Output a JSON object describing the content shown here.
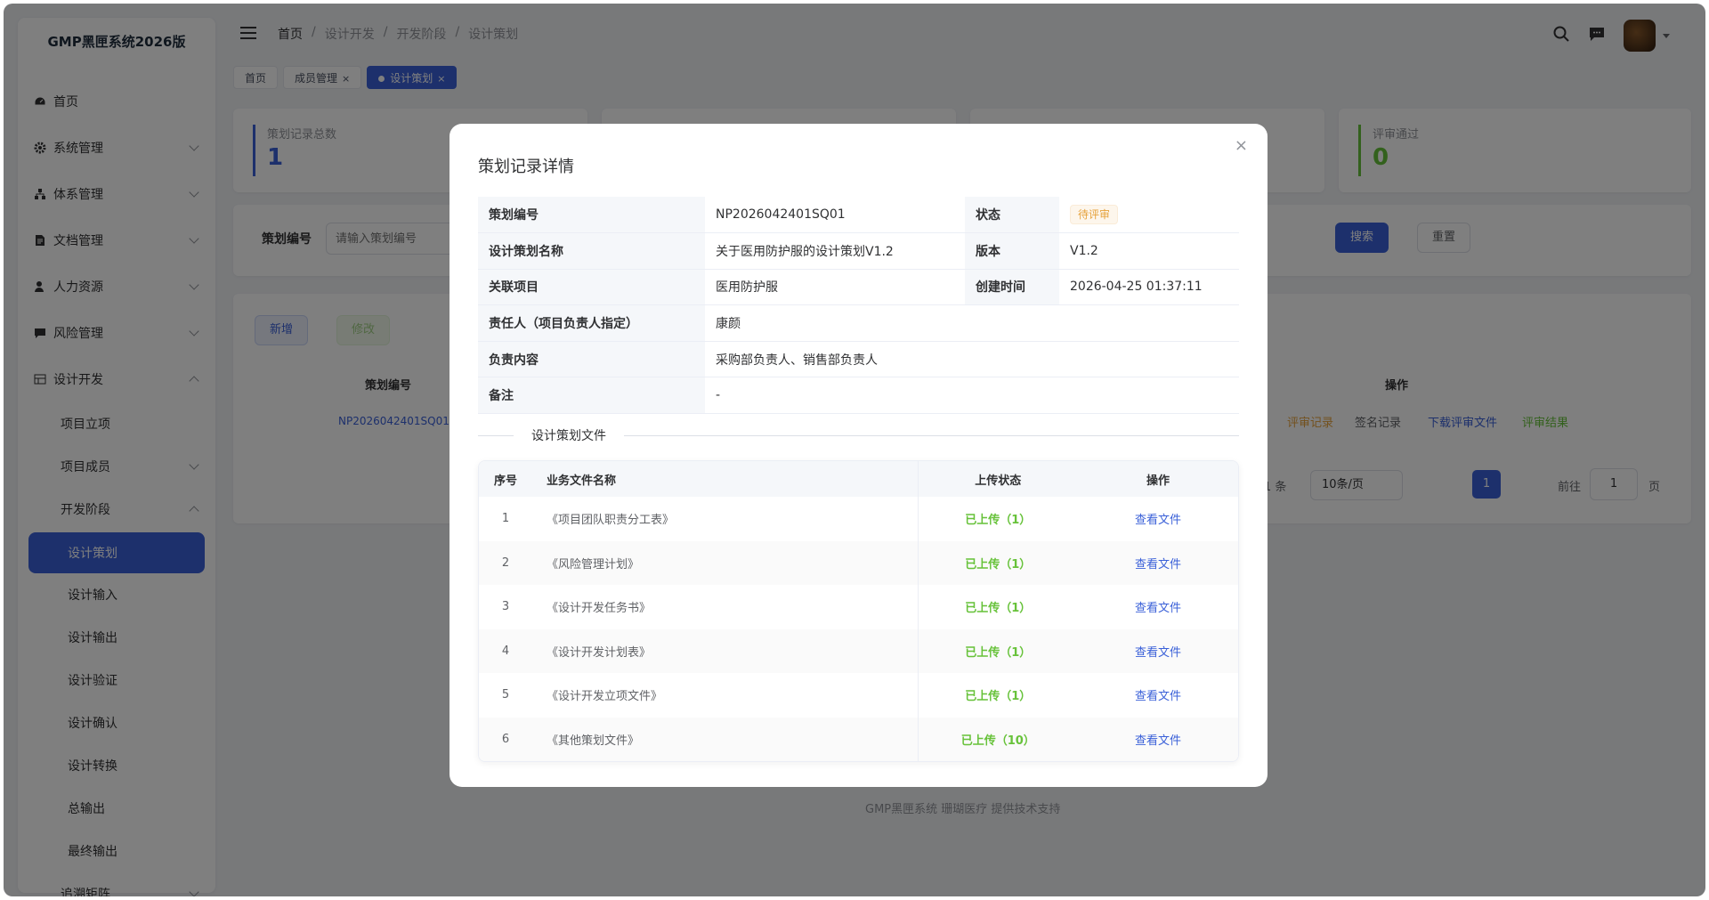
{
  "app": {
    "title": "GMP黑匣系统2026版"
  },
  "sidebar": {
    "items": [
      {
        "label": "首页"
      },
      {
        "label": "系统管理"
      },
      {
        "label": "体系管理"
      },
      {
        "label": "文档管理"
      },
      {
        "label": "人力资源"
      },
      {
        "label": "风险管理"
      },
      {
        "label": "设计开发"
      },
      {
        "label": "项目立项"
      },
      {
        "label": "项目成员"
      },
      {
        "label": "开发阶段"
      },
      {
        "label": "设计策划"
      },
      {
        "label": "设计输入"
      },
      {
        "label": "设计输出"
      },
      {
        "label": "设计验证"
      },
      {
        "label": "设计确认"
      },
      {
        "label": "设计转换"
      },
      {
        "label": "总输出"
      },
      {
        "label": "最终输出"
      },
      {
        "label": "追溯矩阵"
      }
    ]
  },
  "header": {
    "breadcrumb": [
      "首页",
      "设计开发",
      "开发阶段",
      "设计策划"
    ],
    "separator": "/"
  },
  "tags": [
    {
      "label": "首页"
    },
    {
      "label": "成员管理",
      "close": "×"
    },
    {
      "label": "设计策划",
      "close": "×"
    }
  ],
  "stats": [
    {
      "label": "策划记录总数",
      "value": "1",
      "color": "#3a60d8"
    },
    {
      "label": "评审通过",
      "value": "0",
      "color": "#67c23a"
    }
  ],
  "search": {
    "label": "策划编号",
    "placeholder": "请输入策划编号",
    "search_label": "搜索",
    "reset_label": "重置"
  },
  "toolbar": {
    "add_label": "新增",
    "edit_label": "修改"
  },
  "table": {
    "col_code": "策划编号",
    "col_action": "操作",
    "row_code": "NP2026042401SQ01",
    "actions": [
      "评审记录",
      "签名记录",
      "下载评审文件",
      "评审结果"
    ]
  },
  "pagination": {
    "total": "1 条",
    "page_size": "10条/页",
    "current": "1",
    "goto_label": "前往",
    "goto_value": "1",
    "page_suffix": "页"
  },
  "footer": {
    "text": "GMP黑匣系统 珊瑚医疗 提供技术支持"
  },
  "modal": {
    "title": "策划记录详情",
    "close": "×",
    "detail": {
      "code_label": "策划编号",
      "code": "NP2026042401SQ01",
      "status_label": "状态",
      "status": "待评审",
      "name_label": "设计策划名称",
      "name": "关于医用防护服的设计策划V1.2",
      "version_label": "版本",
      "version": "V1.2",
      "project_label": "关联项目",
      "project": "医用防护服",
      "created_label": "创建时间",
      "created": "2026-04-25 01:37:11",
      "owner_label": "责任人（项目负责人指定）",
      "owner": "康颜",
      "scope_label": "负责内容",
      "scope": "采购部负责人、销售部负责人",
      "note_label": "备注",
      "note": "-"
    },
    "files_section": "设计策划文件",
    "files_columns": [
      "序号",
      "业务文件名称",
      "上传状态",
      "操作"
    ],
    "files": [
      {
        "idx": "1",
        "name": "《项目团队职责分工表》",
        "status": "已上传（1）",
        "action": "查看文件"
      },
      {
        "idx": "2",
        "name": "《风险管理计划》",
        "status": "已上传（1）",
        "action": "查看文件"
      },
      {
        "idx": "3",
        "name": "《设计开发任务书》",
        "status": "已上传（1）",
        "action": "查看文件"
      },
      {
        "idx": "4",
        "name": "《设计开发计划表》",
        "status": "已上传（1）",
        "action": "查看文件"
      },
      {
        "idx": "5",
        "name": "《设计开发立项文件》",
        "status": "已上传（1）",
        "action": "查看文件"
      },
      {
        "idx": "6",
        "name": "《其他策划文件》",
        "status": "已上传（10）",
        "action": "查看文件"
      }
    ]
  },
  "colors": {
    "primary": "#3a60d8",
    "success": "#67c23a",
    "warning": "#e6a23c"
  }
}
